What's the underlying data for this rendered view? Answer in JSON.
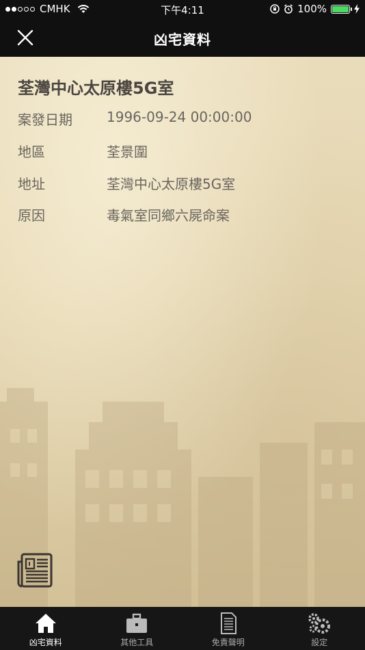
{
  "status_bar": {
    "carrier": "CMHK",
    "time": "下午4:11",
    "battery": "100%",
    "battery_level": 1.0
  },
  "nav": {
    "title": "凶宅資料"
  },
  "record": {
    "title": "荃灣中心太原樓5G室",
    "fields": [
      {
        "label": "案發日期",
        "value": "1996-09-24 00:00:00"
      },
      {
        "label": "地區",
        "value": "荃景圍"
      },
      {
        "label": "地址",
        "value": "荃灣中心太原樓5G室"
      },
      {
        "label": "原因",
        "value": "毒氣室同鄉六屍命案"
      }
    ]
  },
  "tabs": [
    {
      "label": "凶宅資料",
      "icon": "home-icon"
    },
    {
      "label": "其他工具",
      "icon": "briefcase-icon"
    },
    {
      "label": "免責聲明",
      "icon": "document-icon"
    },
    {
      "label": "設定",
      "icon": "gears-icon"
    }
  ],
  "colors": {
    "accent_battery": "#4cd964",
    "bar_background": "#101010",
    "parchment": "#e6d7b2"
  }
}
